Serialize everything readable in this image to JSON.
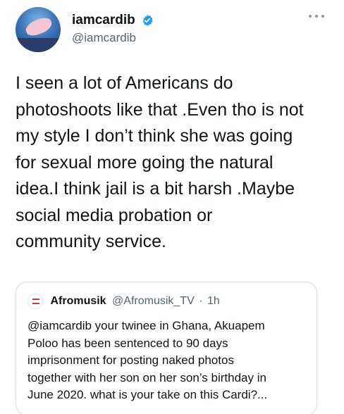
{
  "author": {
    "display_name": "iamcardib",
    "handle": "@iamcardib"
  },
  "tweet": {
    "text": "I seen a lot of Americans do\nphotoshoots like that .Even tho is not\nmy style I don’t think she was going\nfor sexual more going the natural\nidea.I think jail is a bit harsh .Maybe\nsocial media probation or\ncommunity service."
  },
  "quoted_tweet": {
    "display_name": "Afromusik",
    "handle": "@Afromusik_TV",
    "separator": "·",
    "time": "1h",
    "text": "@iamcardib your twinee in Ghana, Akuapem\nPoloo has been sentenced to 90 days\nimprisonment for posting naked photos\ntogether with her son on her son’s birthday in\nJune 2020.  what is your take on this Cardi?..."
  },
  "colors": {
    "verified": "#1d9bf0",
    "secondary_text": "#536471",
    "border": "#d7dde2"
  }
}
